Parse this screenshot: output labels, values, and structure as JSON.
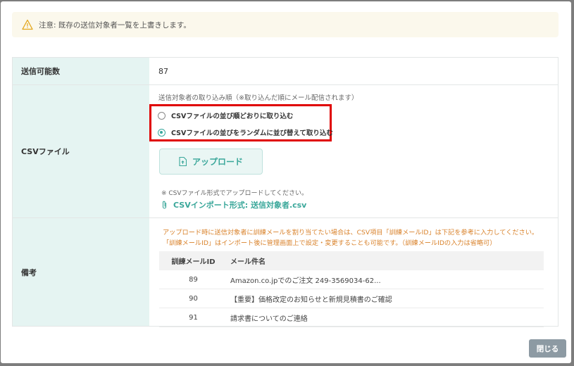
{
  "alert": {
    "icon": "warning-icon",
    "text": "注意: 既存の送信対象者一覧を上書きします。"
  },
  "rows": {
    "count": {
      "label": "送信可能数",
      "value": "87"
    },
    "csv": {
      "label": "CSVファイル",
      "import_order_label": "送信対象者の取り込み順（※取り込んだ順にメール配信されます）",
      "options": [
        {
          "label": "CSVファイルの並び順どおりに取り込む",
          "checked": false
        },
        {
          "label": "CSVファイルの並びをランダムに並び替えて取り込む",
          "checked": true
        }
      ],
      "upload_button": "アップロード",
      "note": "※ CSVファイル形式でアップロードしてください。",
      "template_link": "CSVインポート形式: 送信対象者.csv"
    },
    "remarks": {
      "label": "備考",
      "text_line1": "アップロード時に送信対象者に訓練メールを割り当てたい場合は、CSV項目「訓練メールID」は下記を参考に入力してください。",
      "text_line2": "「訓練メールID」はインポート後に管理画面上で設定・変更することも可能です。（訓練メールIDの入力は省略可）",
      "table": {
        "headers": [
          "訓練メールID",
          "メール件名"
        ],
        "rows": [
          [
            "89",
            "Amazon.co.jpでのご注文 249-3569034-62..."
          ],
          [
            "90",
            "【重要】価格改定のお知らせと新規見積書のご確認"
          ],
          [
            "91",
            "請求書についてのご連絡"
          ]
        ]
      }
    }
  },
  "footer": {
    "close_button": "閉じる"
  },
  "colors": {
    "accent": "#3aa79a",
    "highlight_border": "#e00000",
    "header_bg": "#e5f4f2",
    "warning_text": "#d9822b"
  }
}
